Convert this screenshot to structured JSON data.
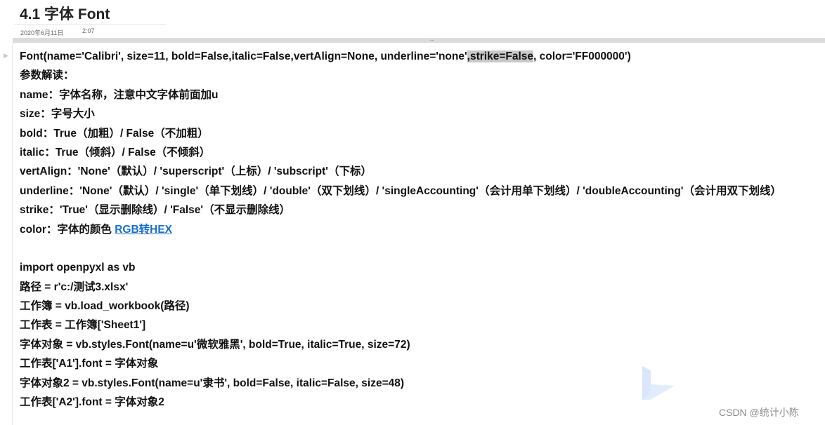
{
  "page": {
    "title": "4.1 字体 Font",
    "date": "2020年6月11日",
    "time": "2:07"
  },
  "signature": {
    "before": "Font(name='Calibri', size=11, bold=False,italic=False,vertAlign=None, underline='none'",
    "selected": ",strike=False",
    "after": ", color='FF000000')"
  },
  "lines": [
    "参数解读：",
    "name：字体名称，注意中文字体前面加u",
    "size：字号大小",
    "bold：True（加粗）/ False（不加粗）",
    "italic：True（倾斜）/ False（不倾斜）",
    "vertAlign：'None'（默认）/ 'superscript'（上标）/ 'subscript'（下标）",
    "underline：'None'（默认）/ 'single'（单下划线）/ 'double'（双下划线）/ 'singleAccounting'（会计用单下划线）/ 'doubleAccounting'（会计用双下划线）",
    "strike：'True'（显示删除线）/ 'False'（不显示删除线）"
  ],
  "color_line": {
    "prefix": "color：字体的颜色 ",
    "link": "RGB转HEX"
  },
  "code": [
    "import openpyxl as vb",
    "路径 = r'c:/测试3.xlsx'",
    "工作簿 = vb.load_workbook(路径)",
    "工作表 = 工作簿['Sheet1']",
    "字体对象 = vb.styles.Font(name=u'微软雅黑', bold=True, italic=True, size=72)",
    "工作表['A1'].font = 字体对象",
    "字体对象2 = vb.styles.Font(name=u'隶书', bold=False, italic=False, size=48)",
    "工作表['A2'].font = 字体对象2"
  ],
  "watermark": "CSDN @统计小陈",
  "colors": {
    "link": "#1a6fc9",
    "selection": "#c8c8c8"
  }
}
